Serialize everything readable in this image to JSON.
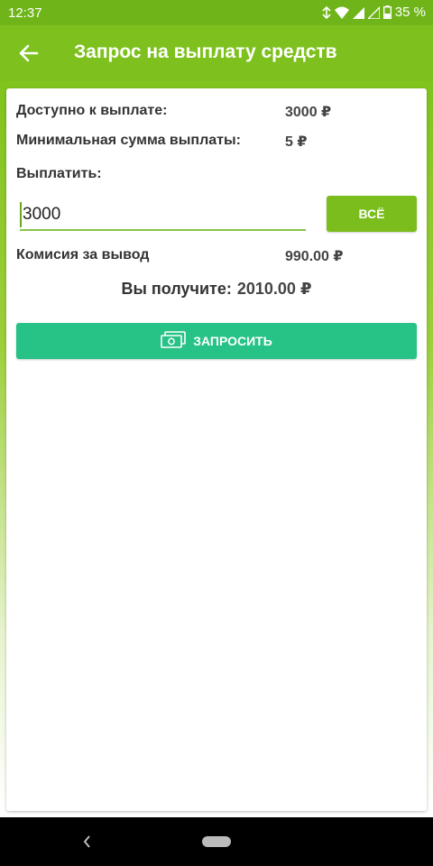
{
  "status_bar": {
    "time": "12:37",
    "battery": "35 %",
    "icons": [
      "data-saver-icon",
      "wifi-icon",
      "signal-icon",
      "signal-icon",
      "battery-icon"
    ]
  },
  "app_bar": {
    "title": "Запрос на выплату средств",
    "back_icon": "arrow-left-icon"
  },
  "form": {
    "available_label": "Доступно к выплате:",
    "available_value": "3000 ₽",
    "min_label": "Минимальная сумма выплаты:",
    "min_value": "5 ₽",
    "pay_label": "Выплатить:",
    "amount_value": "3000",
    "all_button": "ВСЁ",
    "commission_label": "Комисия за вывод",
    "commission_value": "990.00 ₽",
    "receive_label": "Вы получите:",
    "receive_value": "2010.00 ₽",
    "request_button": "ЗАПРОСИТЬ",
    "request_icon": "money-icon"
  },
  "colors": {
    "app_bar": "#7ec11e",
    "status_bar": "#6fb51a",
    "accent_green": "#7bbd1c",
    "request_button": "#26c286"
  }
}
